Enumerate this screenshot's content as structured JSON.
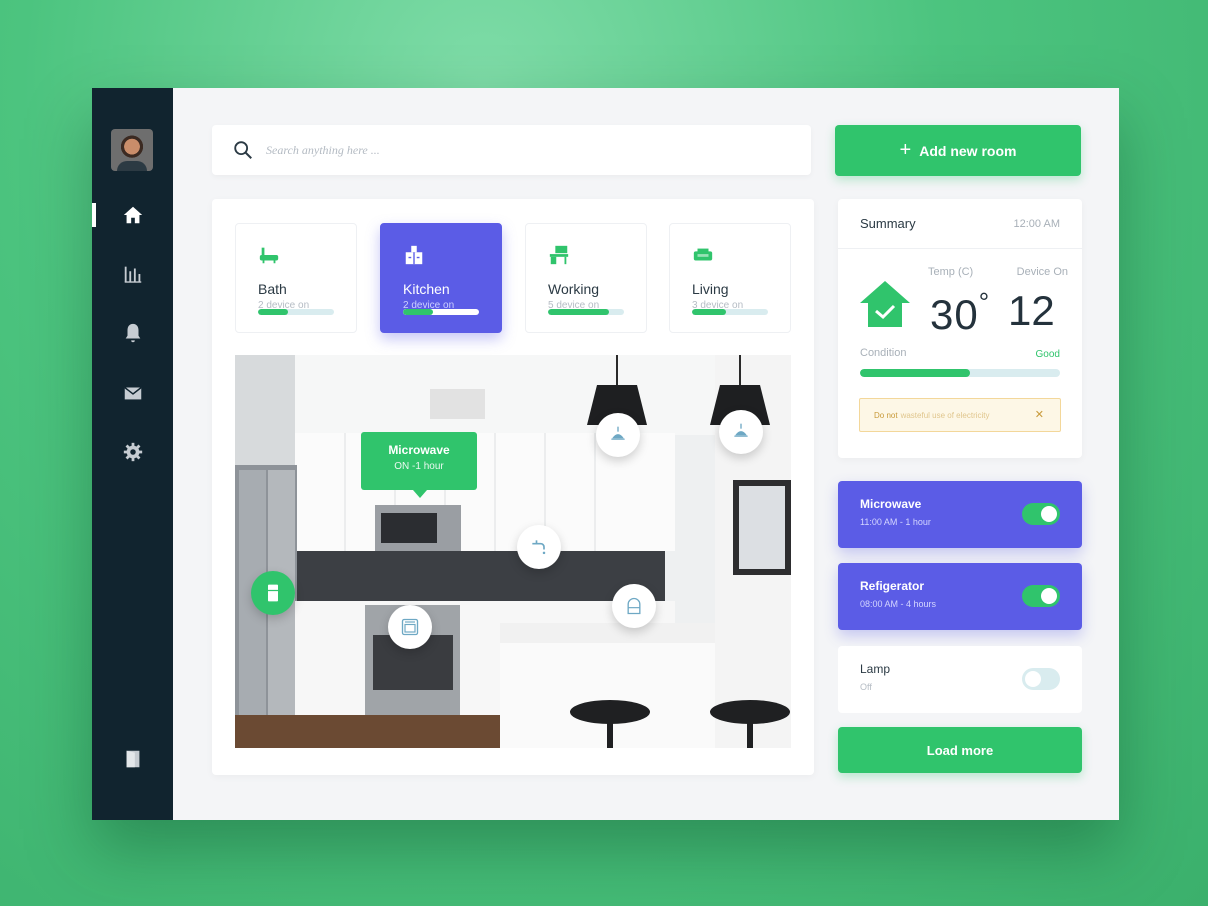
{
  "search": {
    "placeholder": "Search anything here ..."
  },
  "sidebar": {
    "items": [
      {
        "name": "home",
        "icon": "home-icon",
        "active": true
      },
      {
        "name": "stats",
        "icon": "bar-chart-icon"
      },
      {
        "name": "notifications",
        "icon": "bell-icon"
      },
      {
        "name": "messages",
        "icon": "envelope-icon"
      },
      {
        "name": "settings",
        "icon": "gear-icon"
      }
    ],
    "logout_icon": "door-icon"
  },
  "rooms": [
    {
      "name": "Bath",
      "sub": "2 device on",
      "icon": "bathtub-icon",
      "progress": 0.4
    },
    {
      "name": "Kitchen",
      "sub": "2 device on",
      "icon": "kitchen-icon",
      "active": true,
      "progress": 0.4
    },
    {
      "name": "Working",
      "sub": "5 device on",
      "icon": "desk-icon",
      "progress": 0.8
    },
    {
      "name": "Living",
      "sub": "3 device on",
      "icon": "sofa-icon",
      "progress": 0.45
    }
  ],
  "photo": {
    "tooltip": {
      "title": "Microwave",
      "subtitle": "ON -1 hour"
    },
    "hotspots": [
      "fridge-icon",
      "oven-icon",
      "faucet-icon",
      "lamp-icon",
      "lamp-icon",
      "dishwasher-icon"
    ]
  },
  "add_room": {
    "label": "Add new room"
  },
  "summary": {
    "title": "Summary",
    "time": "12:00 AM",
    "temp_label": "Temp (C)",
    "device_label": "Device On",
    "temp_value": "30",
    "degree": "°",
    "device_value": "12",
    "condition_label": "Condition",
    "condition_value": "Good",
    "condition_progress": 0.55,
    "alert_strong": "Do not",
    "alert_text": "wasteful use of electricity",
    "alert_close": "✕"
  },
  "devices": [
    {
      "name": "Microwave",
      "time": "11:00 AM - 1 hour",
      "on": true
    },
    {
      "name": "Refigerator",
      "time": "08:00 AM - 4 hours",
      "on": true
    },
    {
      "name": "Lamp",
      "time": "Off",
      "on": false
    }
  ],
  "load_more": {
    "label": "Load more"
  },
  "colors": {
    "green": "#30c46c",
    "purple": "#5b5ce6",
    "sidebar": "#11242f"
  }
}
